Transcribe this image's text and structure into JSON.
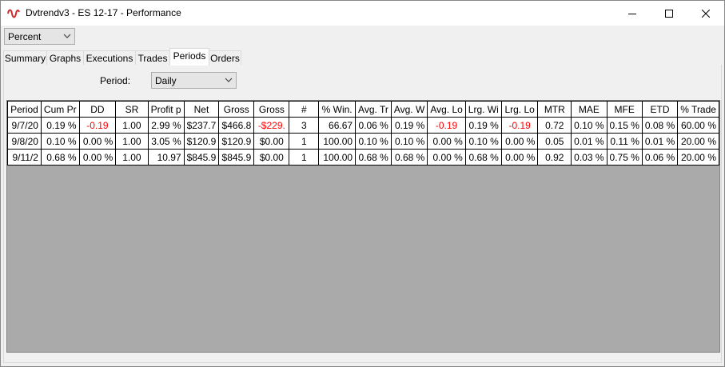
{
  "window": {
    "title": "Dvtrendv3 - ES 12-17 - Performance"
  },
  "display_mode": {
    "selected": "Percent"
  },
  "tabs": [
    {
      "label": "Summary",
      "active": false
    },
    {
      "label": "Graphs",
      "active": false
    },
    {
      "label": "Executions",
      "active": false
    },
    {
      "label": "Trades",
      "active": false
    },
    {
      "label": "Periods",
      "active": true
    },
    {
      "label": "Orders",
      "active": false
    }
  ],
  "period_filter": {
    "label": "Period:",
    "selected": "Daily"
  },
  "table": {
    "headers": [
      "Period",
      "Cum Pr",
      "DD",
      "SR",
      "Profit p",
      "Net",
      "Gross",
      "Gross",
      "#",
      "% Win.",
      "Avg. Tr",
      "Avg. W",
      "Avg. Lo",
      "Lrg. Wi",
      "Lrg. Lo",
      "MTR",
      "MAE",
      "MFE",
      "ETD",
      "% Trade"
    ],
    "rows": [
      [
        "9/7/20",
        "0.19 %",
        "-0.19",
        "1.00",
        "2.99 %",
        "$237.7",
        "$466.8",
        "-$229.",
        "3",
        "66.67",
        "0.06 %",
        "0.19 %",
        "-0.19",
        "0.19 %",
        "-0.19",
        "0.72",
        "0.10 %",
        "0.15 %",
        "0.08 %",
        "60.00 %"
      ],
      [
        "9/8/20",
        "0.10 %",
        "0.00 %",
        "1.00",
        "3.05 %",
        "$120.9",
        "$120.9",
        "$0.00",
        "1",
        "100.00",
        "0.10 %",
        "0.10 %",
        "0.00 %",
        "0.10 %",
        "0.00 %",
        "0.05",
        "0.01 %",
        "0.11 %",
        "0.01 %",
        "20.00 %"
      ],
      [
        "9/11/2",
        "0.68 %",
        "0.00 %",
        "1.00",
        "10.97",
        "$845.9",
        "$845.9",
        "$0.00",
        "1",
        "100.00",
        "0.68 %",
        "0.68 %",
        "0.00 %",
        "0.68 %",
        "0.00 %",
        "0.92",
        "0.03 %",
        "0.75 %",
        "0.06 %",
        "20.00 %"
      ]
    ]
  },
  "colors": {
    "negative": "#ff0000",
    "grid_background": "#aaaaaa"
  },
  "icons": {
    "app": "app-logo-icon",
    "minimize": "minimize-icon",
    "maximize": "maximize-icon",
    "close": "close-icon",
    "dropdown": "chevron-down-icon"
  }
}
